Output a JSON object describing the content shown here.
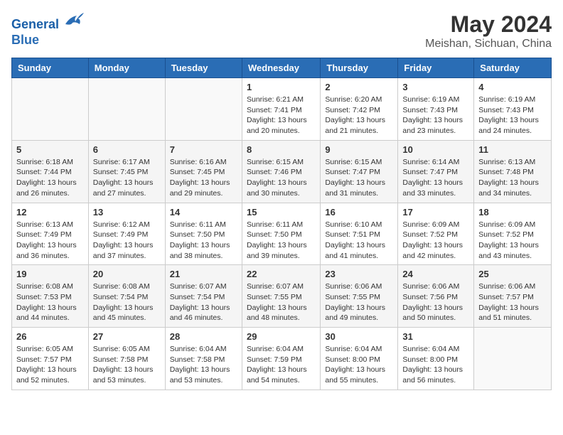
{
  "header": {
    "logo_line1": "General",
    "logo_line2": "Blue",
    "title": "May 2024",
    "subtitle": "Meishan, Sichuan, China"
  },
  "weekdays": [
    "Sunday",
    "Monday",
    "Tuesday",
    "Wednesday",
    "Thursday",
    "Friday",
    "Saturday"
  ],
  "weeks": [
    [
      {
        "day": "",
        "info": ""
      },
      {
        "day": "",
        "info": ""
      },
      {
        "day": "",
        "info": ""
      },
      {
        "day": "1",
        "info": "Sunrise: 6:21 AM\nSunset: 7:41 PM\nDaylight: 13 hours\nand 20 minutes."
      },
      {
        "day": "2",
        "info": "Sunrise: 6:20 AM\nSunset: 7:42 PM\nDaylight: 13 hours\nand 21 minutes."
      },
      {
        "day": "3",
        "info": "Sunrise: 6:19 AM\nSunset: 7:43 PM\nDaylight: 13 hours\nand 23 minutes."
      },
      {
        "day": "4",
        "info": "Sunrise: 6:19 AM\nSunset: 7:43 PM\nDaylight: 13 hours\nand 24 minutes."
      }
    ],
    [
      {
        "day": "5",
        "info": "Sunrise: 6:18 AM\nSunset: 7:44 PM\nDaylight: 13 hours\nand 26 minutes."
      },
      {
        "day": "6",
        "info": "Sunrise: 6:17 AM\nSunset: 7:45 PM\nDaylight: 13 hours\nand 27 minutes."
      },
      {
        "day": "7",
        "info": "Sunrise: 6:16 AM\nSunset: 7:45 PM\nDaylight: 13 hours\nand 29 minutes."
      },
      {
        "day": "8",
        "info": "Sunrise: 6:15 AM\nSunset: 7:46 PM\nDaylight: 13 hours\nand 30 minutes."
      },
      {
        "day": "9",
        "info": "Sunrise: 6:15 AM\nSunset: 7:47 PM\nDaylight: 13 hours\nand 31 minutes."
      },
      {
        "day": "10",
        "info": "Sunrise: 6:14 AM\nSunset: 7:47 PM\nDaylight: 13 hours\nand 33 minutes."
      },
      {
        "day": "11",
        "info": "Sunrise: 6:13 AM\nSunset: 7:48 PM\nDaylight: 13 hours\nand 34 minutes."
      }
    ],
    [
      {
        "day": "12",
        "info": "Sunrise: 6:13 AM\nSunset: 7:49 PM\nDaylight: 13 hours\nand 36 minutes."
      },
      {
        "day": "13",
        "info": "Sunrise: 6:12 AM\nSunset: 7:49 PM\nDaylight: 13 hours\nand 37 minutes."
      },
      {
        "day": "14",
        "info": "Sunrise: 6:11 AM\nSunset: 7:50 PM\nDaylight: 13 hours\nand 38 minutes."
      },
      {
        "day": "15",
        "info": "Sunrise: 6:11 AM\nSunset: 7:50 PM\nDaylight: 13 hours\nand 39 minutes."
      },
      {
        "day": "16",
        "info": "Sunrise: 6:10 AM\nSunset: 7:51 PM\nDaylight: 13 hours\nand 41 minutes."
      },
      {
        "day": "17",
        "info": "Sunrise: 6:09 AM\nSunset: 7:52 PM\nDaylight: 13 hours\nand 42 minutes."
      },
      {
        "day": "18",
        "info": "Sunrise: 6:09 AM\nSunset: 7:52 PM\nDaylight: 13 hours\nand 43 minutes."
      }
    ],
    [
      {
        "day": "19",
        "info": "Sunrise: 6:08 AM\nSunset: 7:53 PM\nDaylight: 13 hours\nand 44 minutes."
      },
      {
        "day": "20",
        "info": "Sunrise: 6:08 AM\nSunset: 7:54 PM\nDaylight: 13 hours\nand 45 minutes."
      },
      {
        "day": "21",
        "info": "Sunrise: 6:07 AM\nSunset: 7:54 PM\nDaylight: 13 hours\nand 46 minutes."
      },
      {
        "day": "22",
        "info": "Sunrise: 6:07 AM\nSunset: 7:55 PM\nDaylight: 13 hours\nand 48 minutes."
      },
      {
        "day": "23",
        "info": "Sunrise: 6:06 AM\nSunset: 7:55 PM\nDaylight: 13 hours\nand 49 minutes."
      },
      {
        "day": "24",
        "info": "Sunrise: 6:06 AM\nSunset: 7:56 PM\nDaylight: 13 hours\nand 50 minutes."
      },
      {
        "day": "25",
        "info": "Sunrise: 6:06 AM\nSunset: 7:57 PM\nDaylight: 13 hours\nand 51 minutes."
      }
    ],
    [
      {
        "day": "26",
        "info": "Sunrise: 6:05 AM\nSunset: 7:57 PM\nDaylight: 13 hours\nand 52 minutes."
      },
      {
        "day": "27",
        "info": "Sunrise: 6:05 AM\nSunset: 7:58 PM\nDaylight: 13 hours\nand 53 minutes."
      },
      {
        "day": "28",
        "info": "Sunrise: 6:04 AM\nSunset: 7:58 PM\nDaylight: 13 hours\nand 53 minutes."
      },
      {
        "day": "29",
        "info": "Sunrise: 6:04 AM\nSunset: 7:59 PM\nDaylight: 13 hours\nand 54 minutes."
      },
      {
        "day": "30",
        "info": "Sunrise: 6:04 AM\nSunset: 8:00 PM\nDaylight: 13 hours\nand 55 minutes."
      },
      {
        "day": "31",
        "info": "Sunrise: 6:04 AM\nSunset: 8:00 PM\nDaylight: 13 hours\nand 56 minutes."
      },
      {
        "day": "",
        "info": ""
      }
    ]
  ]
}
